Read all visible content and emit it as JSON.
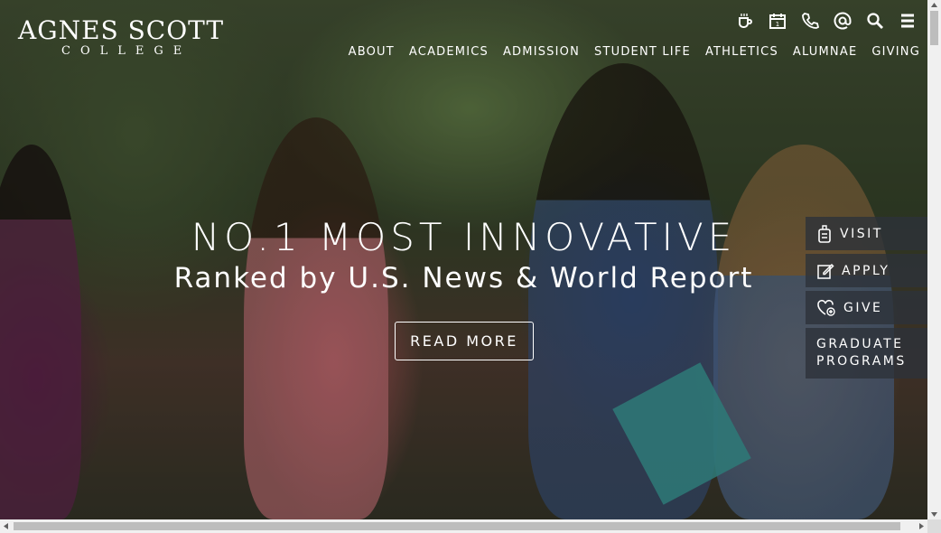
{
  "logo": {
    "main": "AGNES SCOTT",
    "sub": "COLLEGE"
  },
  "utility_icons": [
    "coffee-cup-icon",
    "calendar-icon",
    "phone-icon",
    "at-sign-icon",
    "search-icon",
    "menu-icon"
  ],
  "calendar_day": "1",
  "nav": [
    "ABOUT",
    "ACADEMICS",
    "ADMISSION",
    "STUDENT LIFE",
    "ATHLETICS",
    "ALUMNAE",
    "GIVING"
  ],
  "hero": {
    "title": "NO.1 MOST INNOVATIVE",
    "subtitle": "Ranked by U.S. News & World Report",
    "button": "READ MORE"
  },
  "ctas": {
    "visit": "VISIT",
    "apply": "APPLY",
    "give": "GIVE",
    "graduate_line1": "GRADUATE",
    "graduate_line2": "PROGRAMS"
  },
  "colors": {
    "cta_bg": "#2d323a",
    "text": "#ffffff"
  }
}
